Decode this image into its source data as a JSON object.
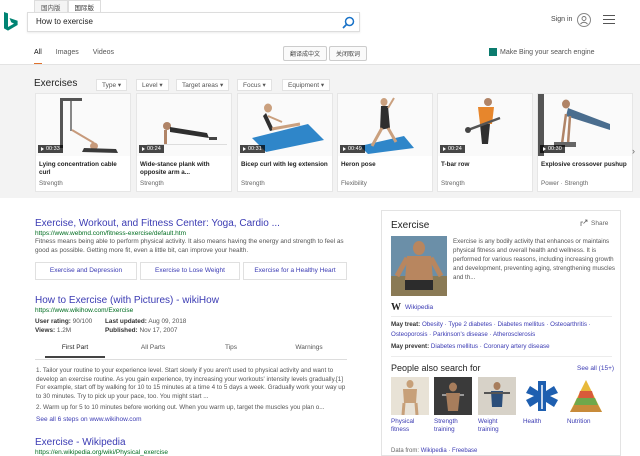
{
  "header": {
    "locale_tabs": [
      "国内版",
      "国际版"
    ],
    "search_value": "How to exercise",
    "sign_in": "Sign in"
  },
  "scope_tabs": [
    "All",
    "Images",
    "Videos"
  ],
  "toolbar": {
    "translate": "翻译成中文",
    "close_translate": "关闭取词",
    "homepage": "Make Bing your search engine"
  },
  "exercises": {
    "title": "Exercises",
    "filters": [
      "Type",
      "Level",
      "Target areas",
      "Focus",
      "Equipment"
    ],
    "cards": [
      {
        "duration": "00:33",
        "name": "Lying concentration cable curl",
        "category": "Strength"
      },
      {
        "duration": "00:24",
        "name": "Wide-stance plank with opposite arm a...",
        "category": "Strength"
      },
      {
        "duration": "00:31",
        "name": "Bicep curl with leg extension",
        "category": "Strength"
      },
      {
        "duration": "00:49",
        "name": "Heron pose",
        "category": "Flexibility"
      },
      {
        "duration": "00:24",
        "name": "T-bar row",
        "category": "Strength"
      },
      {
        "duration": "00:30",
        "name": "Explosive crossover pushup",
        "category": "Power · Strength"
      }
    ]
  },
  "results": [
    {
      "title": "Exercise, Workout, and Fitness Center: Yoga, Cardio ...",
      "url": "https://www.webmd.com/fitness-exercise/default.htm",
      "snippet": "Fitness means being able to perform physical activity. It also means having the energy and strength to feel as good as possible. Getting more fit, even a little bit, can improve your health.",
      "deeplinks": [
        "Exercise and Depression",
        "Exercise to Lose Weight",
        "Exercise for a Healthy Heart"
      ]
    },
    {
      "title": "How to Exercise (with Pictures) - wikiHow",
      "url": "https://www.wikihow.com/Exercise",
      "rating_label": "User rating:",
      "rating": "90/100",
      "updated_label": "Last updated:",
      "updated": "Aug 09, 2018",
      "views_label": "Views:",
      "views": "1.2M",
      "published_label": "Published:",
      "published": "Nov 17, 2007",
      "subtabs": [
        "First Part",
        "All Parts",
        "Tips",
        "Warnings"
      ],
      "step1": "1.  Tailor your routine to your experience level. Start slowly if you aren't used to physical activity and want to develop an exercise routine. As you gain experience, try increasing your workouts' intensity levels gradually.[1] For example, start off by walking for 10 to 15 minutes at a time 4 to 5 days a week. Gradually work your way up to 30 minutes. Try to pick up your pace, too. You might start ...",
      "step2": "2.  Warm up for 5 to 10 minutes before working out. When you warm up, target the muscles you plan o...",
      "see_all": "See all 6 steps on www.wikihow.com"
    },
    {
      "title": "Exercise - Wikipedia",
      "url": "https://en.wikipedia.org/wiki/Physical_exercise"
    }
  ],
  "knowledge_panel": {
    "title": "Exercise",
    "share": "Share",
    "description": "Exercise is any bodily activity that enhances or maintains physical fitness and overall health and wellness. It is performed for various reasons, including increasing growth and development, preventing aging, strengthening muscles and th...",
    "source": "Wikipedia",
    "may_treat_label": "May treat:",
    "may_treat": "Obesity · Type 2 diabetes · Diabetes mellitus · Osteoarthritis · Osteoporosis · Parkinson's disease · Atherosclerosis",
    "may_prevent_label": "May prevent:",
    "may_prevent": "Diabetes mellitus · Coronary artery disease",
    "pas_title": "People also search for",
    "pas_see_all": "See all (15+)",
    "pas_items": [
      "Physical fitness",
      "Strength training",
      "Weight training",
      "Health",
      "Nutrition"
    ],
    "data_from_label": "Data from:",
    "data_from": "Wikipedia · Freebase"
  },
  "colors": {
    "link": "#3b3bb3",
    "url": "#006d21",
    "accent": "#e0722d",
    "bing_teal": "#0b7b6e"
  }
}
